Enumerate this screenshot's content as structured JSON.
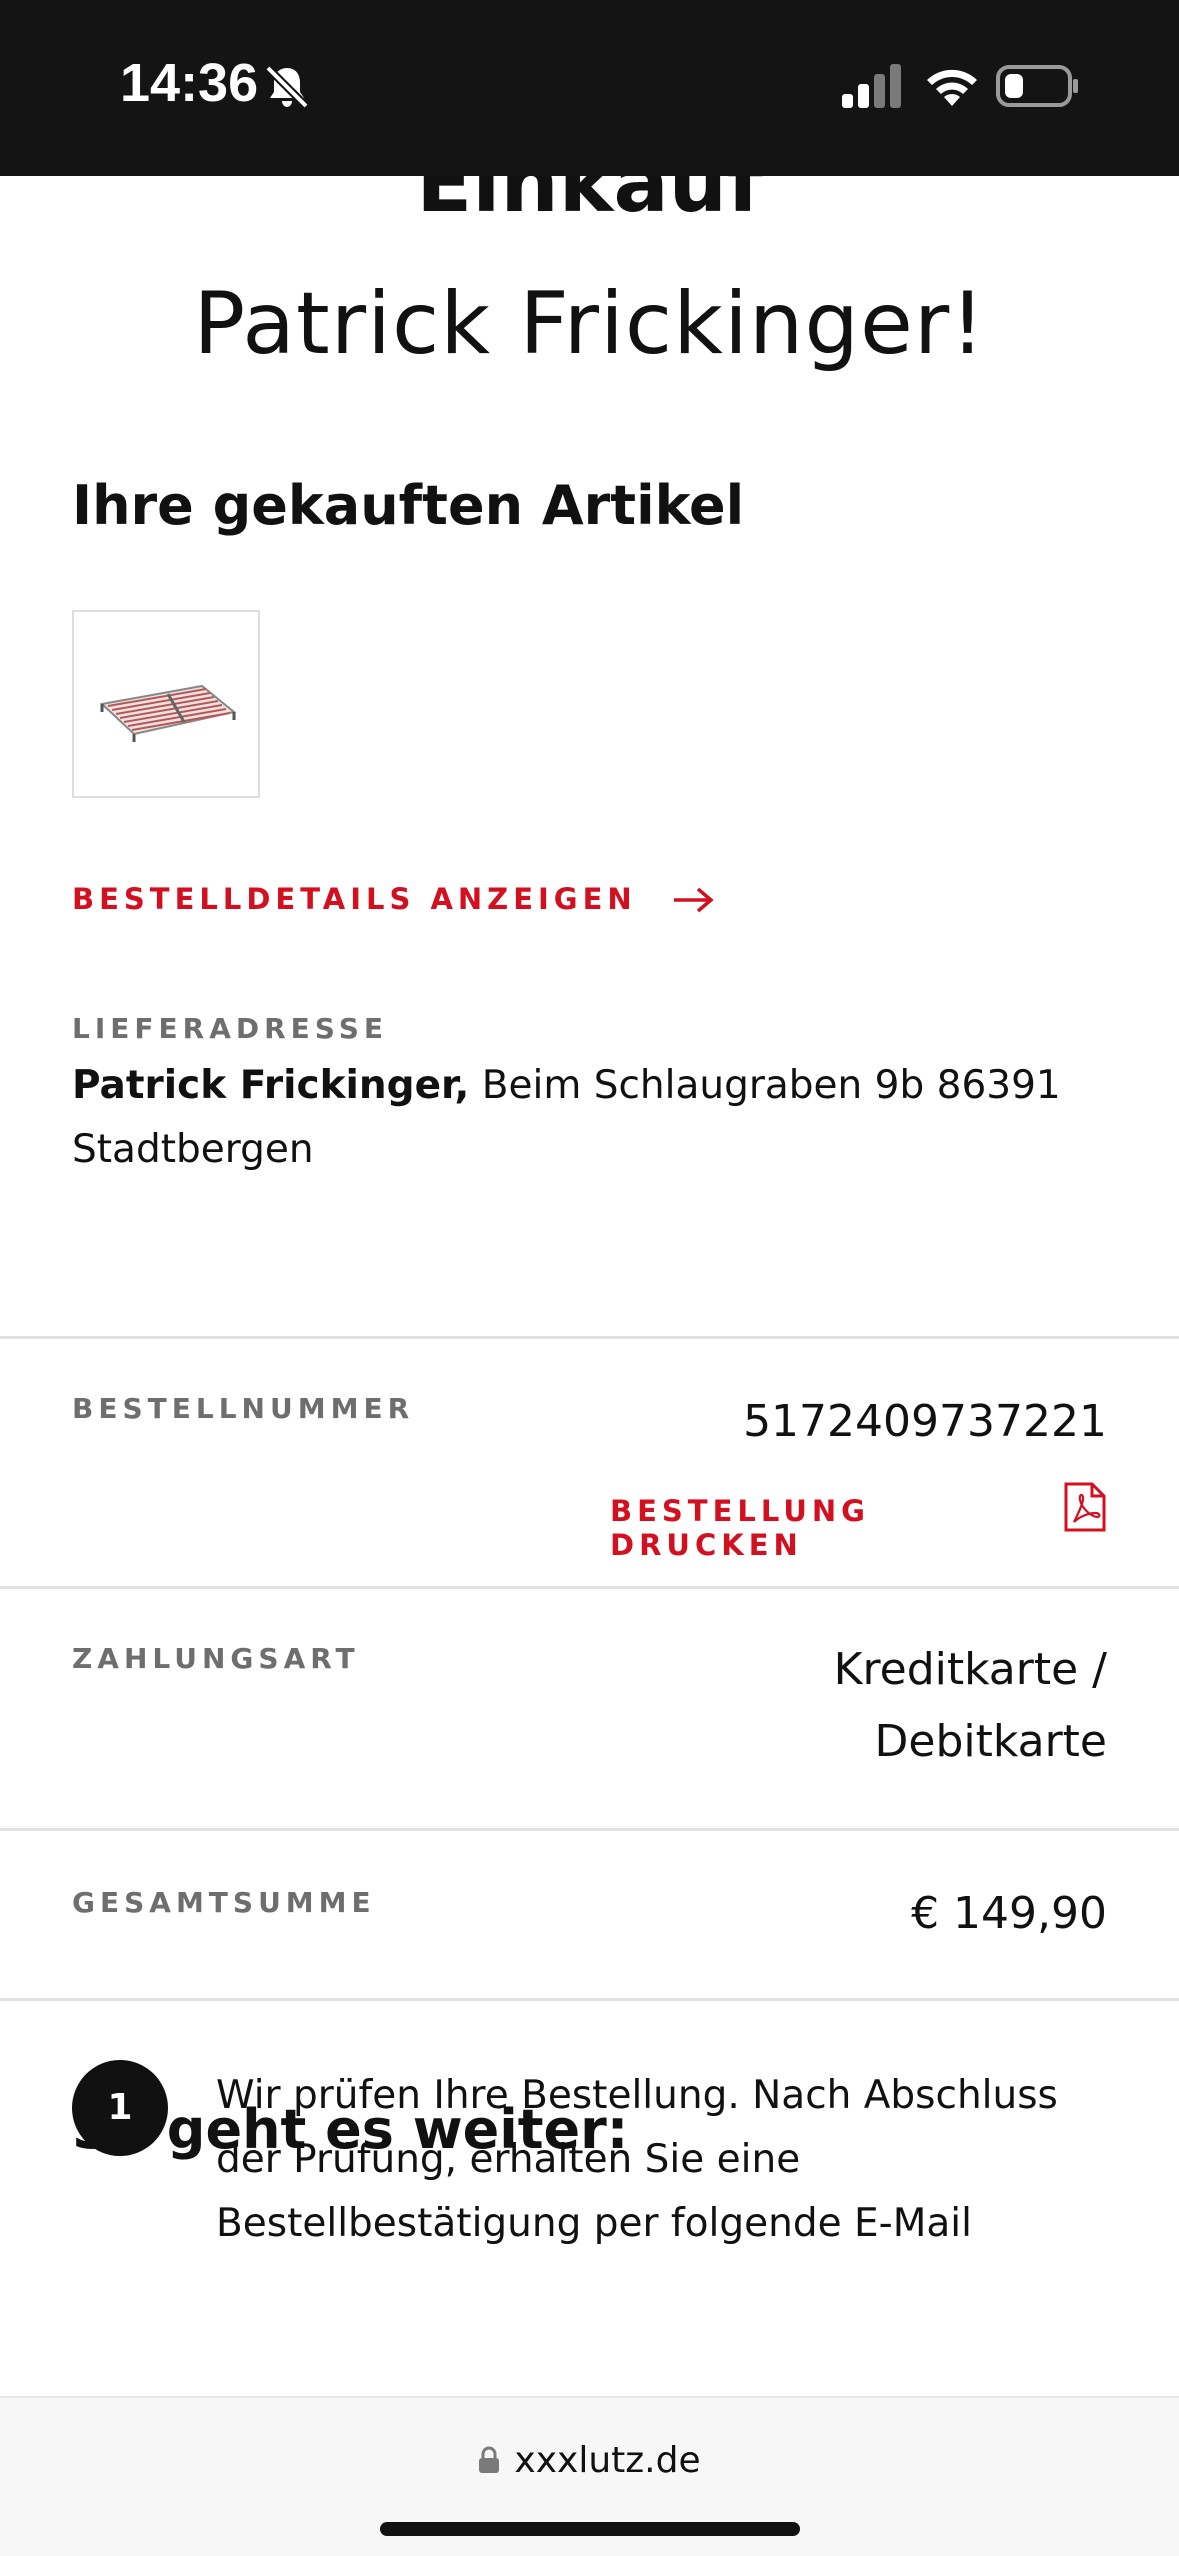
{
  "status_bar": {
    "time": "14:36",
    "icons": [
      "bell-off-icon",
      "signal-icon",
      "wifi-icon",
      "battery-icon"
    ]
  },
  "header": {
    "title_line1": "Einkauf",
    "title_line2": "Patrick Frickinger!"
  },
  "purchased": {
    "heading": "Ihre gekauften Artikel",
    "thumbnail_icon": "slatted-frame-image",
    "details_link": "BESTELLDETAILS ANZEIGEN"
  },
  "delivery": {
    "label": "LIEFERADRESSE",
    "name": "Patrick Frickinger,",
    "address": "Beim Schlaugraben 9b 86391 Stadtbergen"
  },
  "order": {
    "number_label": "BESTELLNUMMER",
    "number_value": "5172409737221",
    "print_link": "BESTELLUNG DRUCKEN",
    "payment_label": "ZAHLUNGSART",
    "payment_value_line1": "Kreditkarte /",
    "payment_value_line2": "Debitkarte",
    "total_label": "GESAMTSUMME",
    "total_value": "€ 149,90"
  },
  "next_steps": {
    "heading": "So geht es weiter:",
    "step1_number": "1",
    "step1_text": "Wir prüfen Ihre Bestellung. Nach Abschluss der Prüfung, erhalten Sie eine Bestellbestätigung per folgende E-Mail"
  },
  "browser": {
    "url": "xxxlutz.de"
  },
  "colors": {
    "accent": "#d3101f",
    "text": "#111111",
    "muted": "#6e6e6e"
  }
}
